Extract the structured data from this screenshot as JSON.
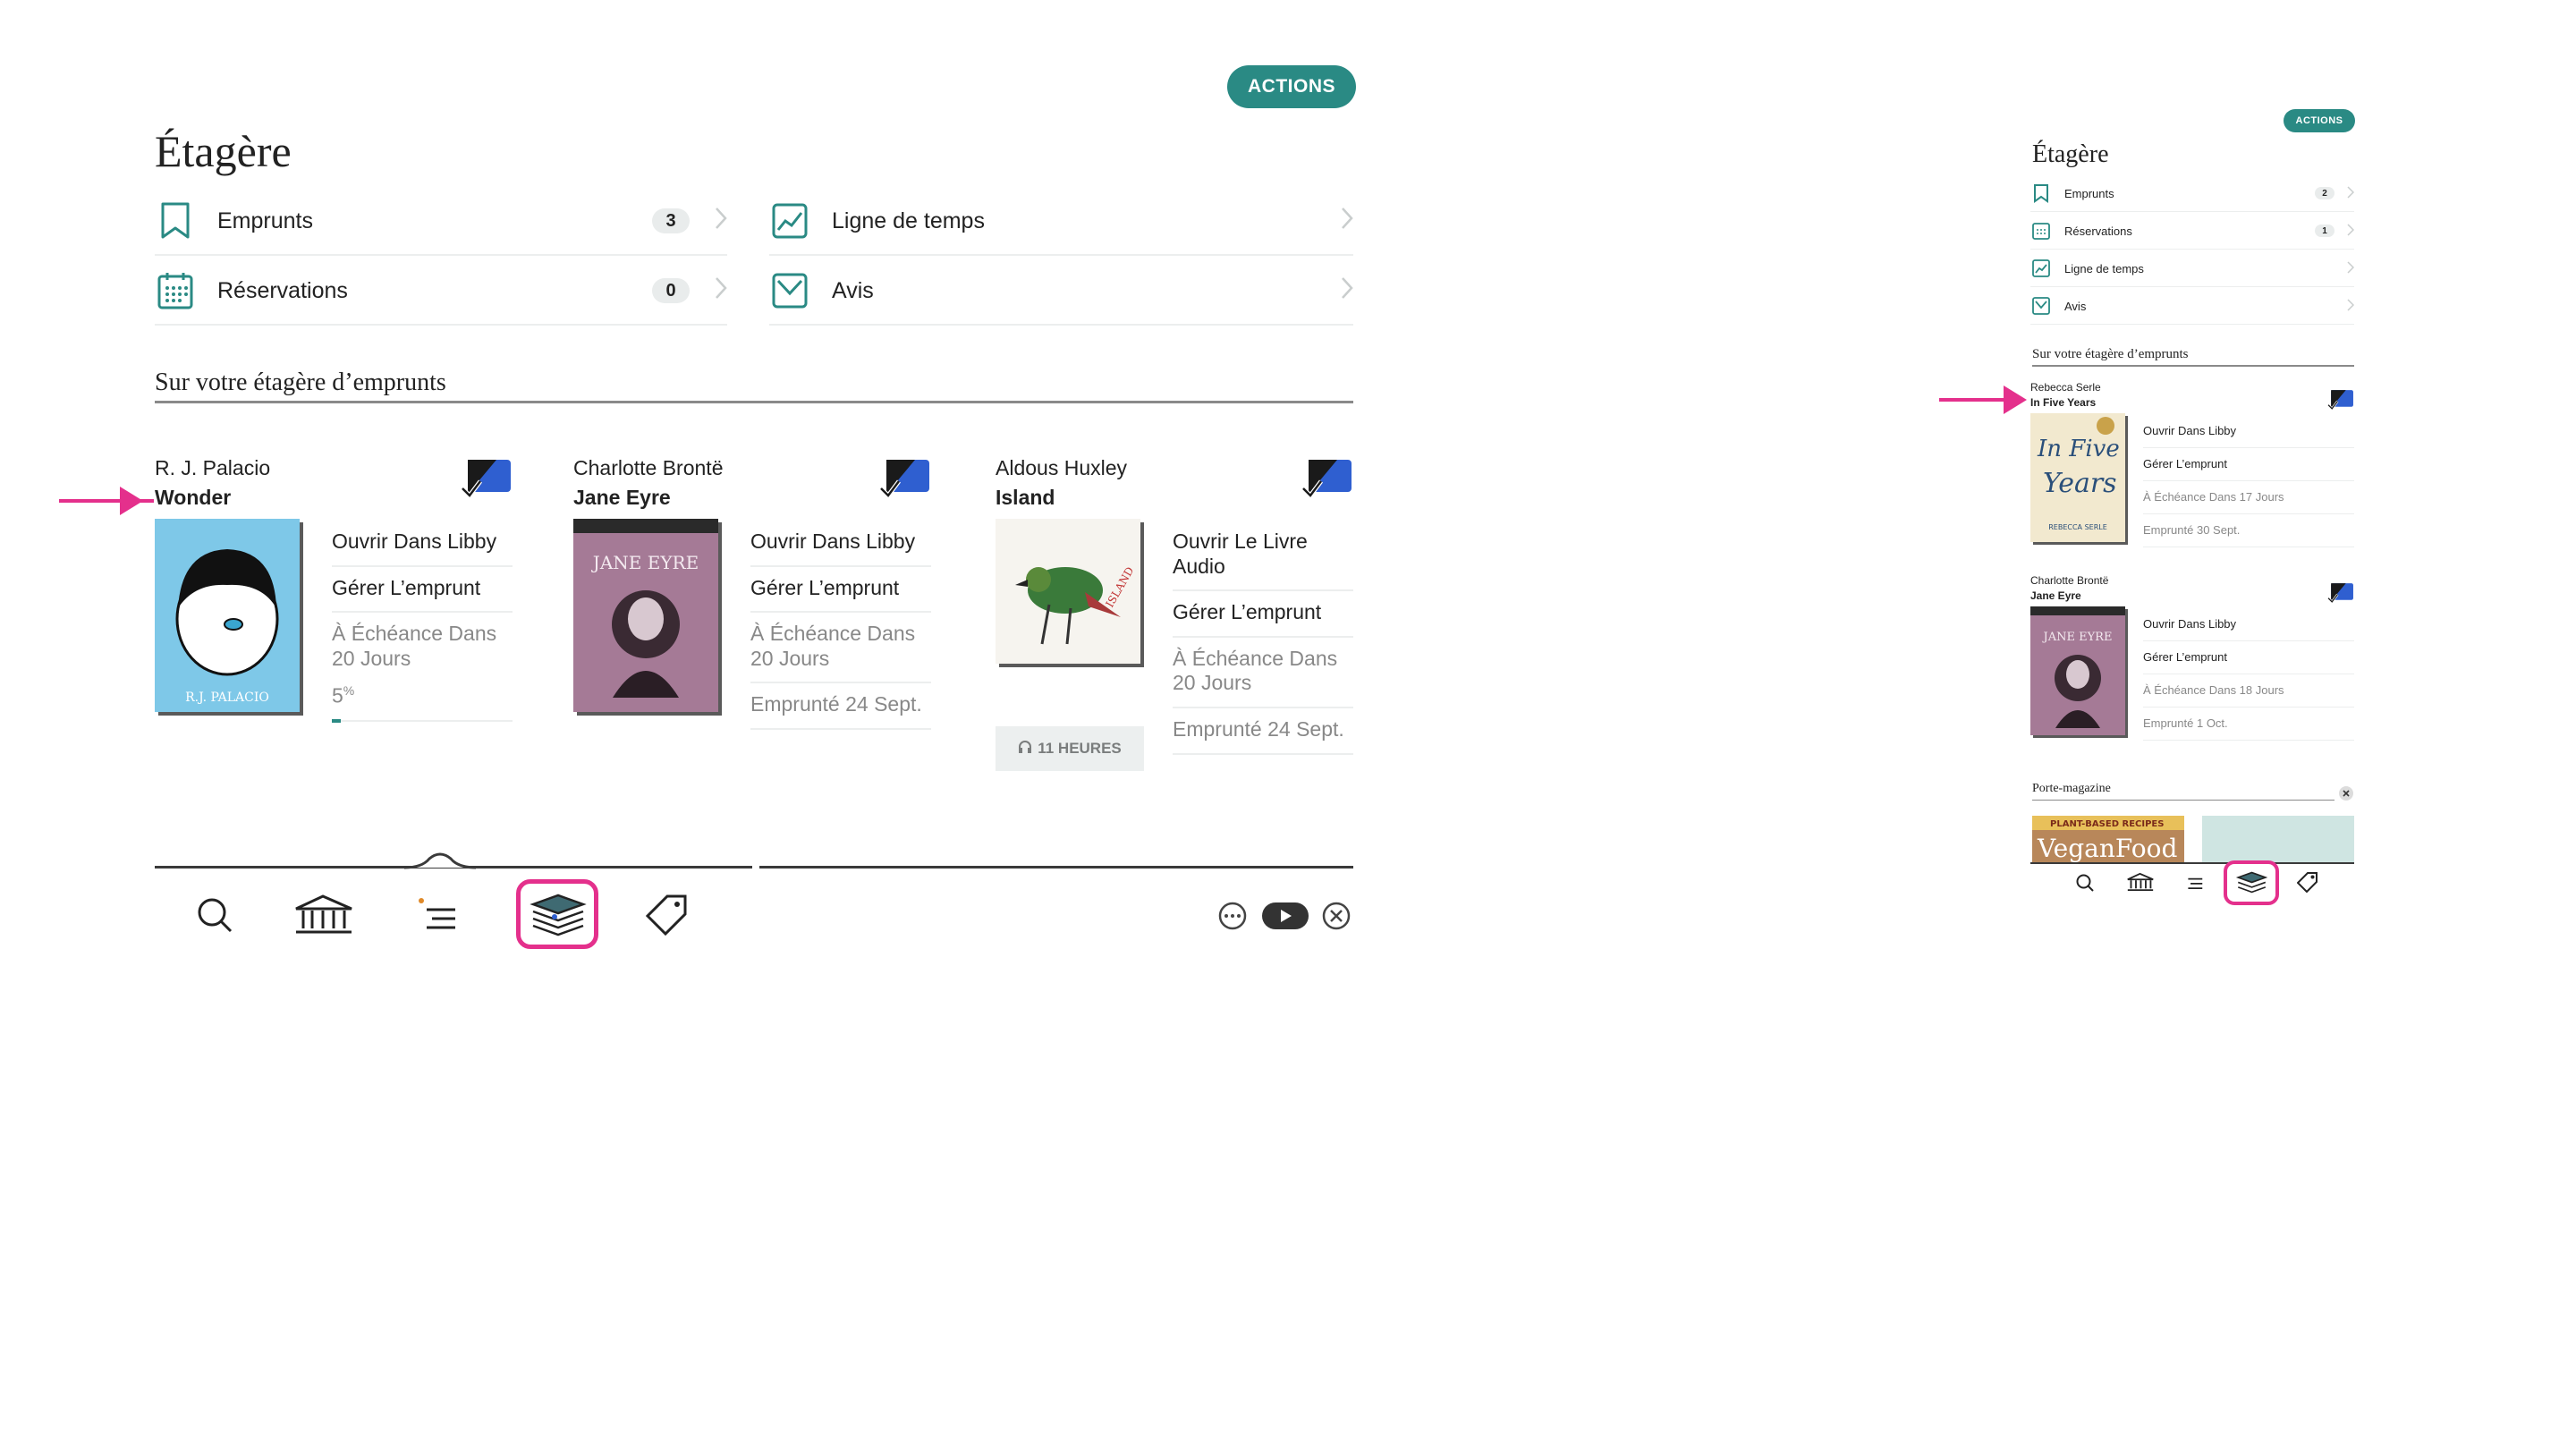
{
  "tablet": {
    "actions_label": "ACTIONS",
    "title": "Étagère",
    "menu": [
      {
        "label": "Emprunts",
        "count": "3",
        "icon": "bookmark-icon"
      },
      {
        "label": "Réservations",
        "count": "0",
        "icon": "calendar-icon"
      },
      {
        "label": "Ligne de temps",
        "icon": "timeline-chart-icon"
      },
      {
        "label": "Avis",
        "icon": "review-check-icon"
      }
    ],
    "section_title": "Sur votre étagère d’emprunts",
    "books": [
      {
        "author": "R. J. Palacio",
        "title": "Wonder",
        "cover_text": "R.J. PALACIO",
        "actions": [
          "Ouvrir Dans Libby",
          "Gérer L’emprunt",
          "À Échéance Dans 20 Jours"
        ],
        "progress_value": "5",
        "progress_unit": "%",
        "progress_fraction": 0.05
      },
      {
        "author": "Charlotte Brontë",
        "title": "Jane Eyre",
        "cover_text": "JANE EYRE",
        "actions": [
          "Ouvrir Dans Libby",
          "Gérer L’emprunt",
          "À Échéance Dans 20 Jours",
          "Emprunté 24 Sept."
        ]
      },
      {
        "author": "Aldous Huxley",
        "title": "Island",
        "cover_text": "ISLAND",
        "duration": "11 HEURES",
        "actions": [
          "Ouvrir Le Livre Audio",
          "Gérer L’emprunt",
          "À Échéance Dans 20 Jours",
          "Emprunté 24 Sept."
        ]
      }
    ],
    "nav": [
      "search-icon",
      "library-icon",
      "menu-icon",
      "shelf-icon",
      "tag-icon"
    ],
    "controls": [
      "more-icon",
      "play-icon",
      "close-icon"
    ]
  },
  "phone": {
    "actions_label": "ACTIONS",
    "title": "Étagère",
    "menu": [
      {
        "label": "Emprunts",
        "count": "2",
        "icon": "bookmark-icon"
      },
      {
        "label": "Réservations",
        "count": "1",
        "icon": "calendar-icon"
      },
      {
        "label": "Ligne de temps",
        "icon": "timeline-chart-icon"
      },
      {
        "label": "Avis",
        "icon": "review-check-icon"
      }
    ],
    "section_title": "Sur votre étagère d’emprunts",
    "books": [
      {
        "author": "Rebecca Serle",
        "title": "In Five Years",
        "cover_lines": [
          "In Five",
          "Years",
          "REBECCA SERLE"
        ],
        "actions": [
          "Ouvrir Dans Libby",
          "Gérer L’emprunt",
          "À Échéance Dans 17 Jours",
          "Emprunté 30 Sept."
        ]
      },
      {
        "author": "Charlotte Brontë",
        "title": "Jane Eyre",
        "cover_text": "JANE EYRE",
        "actions": [
          "Ouvrir Dans Libby",
          "Gérer L’emprunt",
          "À Échéance Dans 18 Jours",
          "Emprunté 1 Oct."
        ]
      }
    ],
    "magazine_section": "Porte-magazine",
    "magazine_cover": [
      "PLANT-BASED RECIPES",
      "VeganFood"
    ]
  },
  "colors": {
    "accent": "#2a8a84",
    "highlight": "#e4308c",
    "tag_blue": "#2f5fd0"
  }
}
